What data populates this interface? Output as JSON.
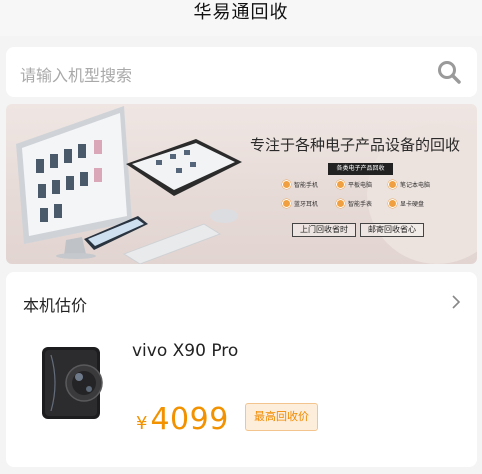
{
  "header": {
    "title": "华易通回收"
  },
  "search": {
    "placeholder": "请输入机型搜索",
    "icon": "search-icon"
  },
  "banner": {
    "headline": "专注于各种电子产品设备的回收",
    "subtag": "各类电子产品回收",
    "categories": [
      "智能手机",
      "平板电脑",
      "笔记本电脑",
      "蓝牙耳机",
      "智能手表",
      "显卡硬盘"
    ],
    "buttons": [
      "上门回收省时",
      "邮寄回收省心"
    ]
  },
  "estimate": {
    "title": "本机估价",
    "model": "vivo X90 Pro",
    "currency": "¥",
    "price": "4099",
    "tag": "最高回收价"
  },
  "colors": {
    "accent": "#f39200",
    "tag_bg": "#fdeedb"
  }
}
